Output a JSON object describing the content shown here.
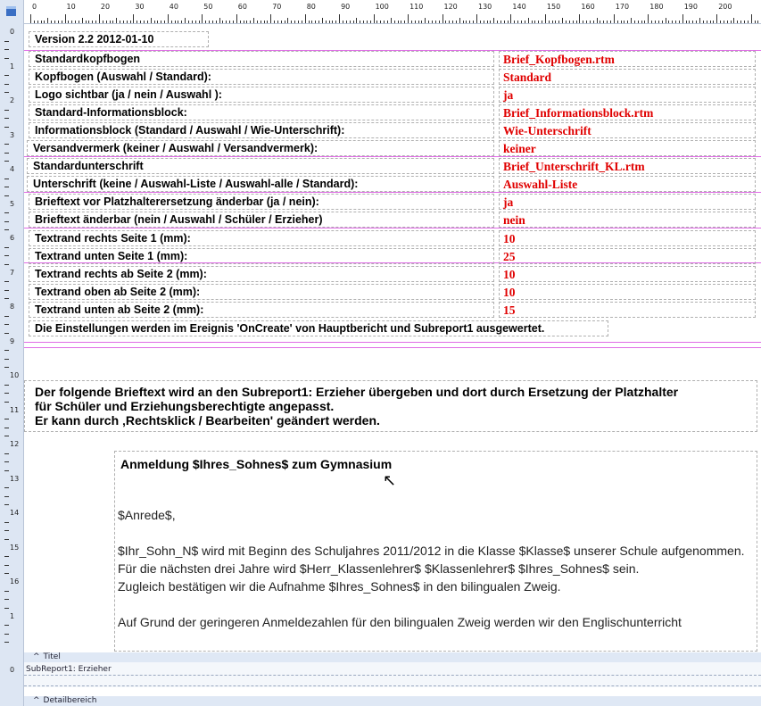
{
  "ruler": {
    "top_labels": [
      "0",
      "10",
      "20",
      "30",
      "40",
      "50",
      "60",
      "70",
      "80",
      "90",
      "100",
      "110",
      "120",
      "130",
      "140",
      "150",
      "160",
      "170",
      "180",
      "190",
      "200"
    ],
    "left_labels": [
      "0",
      "1",
      "2",
      "3",
      "4",
      "5",
      "6",
      "7",
      "8",
      "9",
      "10",
      "11",
      "12",
      "13",
      "14",
      "15",
      "16",
      "1"
    ]
  },
  "settings": {
    "version": "Version 2.2 2012-01-10",
    "rows": [
      {
        "label": "Standardkopfbogen",
        "value": "Brief_Kopfbogen.rtm"
      },
      {
        "label": "Kopfbogen  (Auswahl / Standard):",
        "value": "Standard"
      },
      {
        "label": "Logo sichtbar  (ja / nein / Auswahl ):",
        "value": "ja"
      },
      {
        "label": "Standard-Informationsblock:",
        "value": "Brief_Informationsblock.rtm"
      },
      {
        "label": "Informationsblock (Standard / Auswahl / Wie-Unterschrift):",
        "value": "Wie-Unterschrift"
      },
      {
        "label": "Versandvermerk (keiner / Auswahl / Versandvermerk):",
        "value": "keiner"
      },
      {
        "label": "Standardunterschrift",
        "value": "Brief_Unterschrift_KL.rtm"
      },
      {
        "label": "Unterschrift (keine / Auswahl-Liste / Auswahl-alle / Standard):",
        "value": "Auswahl-Liste"
      },
      {
        "label": "Brieftext vor Platzhalterersetzung änderbar (ja / nein):",
        "value": "ja"
      },
      {
        "label": "Brieftext änderbar (nein / Auswahl  / Schüler / Erzieher)",
        "value": "nein"
      },
      {
        "label": "Textrand rechts Seite 1       (mm):",
        "value": "10"
      },
      {
        "label": "Textrand unten Seite 1        (mm):",
        "value": "25"
      },
      {
        "label": "Textrand rechts ab Seite 2  (mm):",
        "value": "10"
      },
      {
        "label": "Textrand oben ab Seite 2     (mm):",
        "value": "10"
      },
      {
        "label": "Textrand unten ab Seite 2   (mm):",
        "value": "15"
      }
    ],
    "evaluation_note": "Die Einstellungen werden im Ereignis 'OnCreate' von Hauptbericht und Subreport1 ausgewertet."
  },
  "note": {
    "line1": "Der folgende Brieftext wird an den Subreport1: Erzieher übergeben und dort durch Ersetzung der Platzhalter",
    "line2": "für Schüler und Erziehungsberechtigte angepasst.",
    "line3": "Er kann durch ‚Rechtsklick / Bearbeiten' geändert werden."
  },
  "letter": {
    "subject": "Anmeldung $Ihres_Sohnes$ zum Gymnasium",
    "salutation": "$Anrede$,",
    "p1": "$Ihr_Sohn_N$ wird mit Beginn des Schuljahres 2011/2012 in die Klasse $Klasse$ unserer Schule aufgenommen.",
    "p2": "Für die nächsten drei Jahre wird $Herr_Klassenlehrer$ $Klassenlehrer$ $Ihres_Sohnes$ sein.",
    "p3": "Zugleich bestätigen wir die Aufnahme $Ihres_Sohnes$ in den bilingualen Zweig.",
    "p4": "Auf Grund der geringeren Anmeldezahlen für den bilingualen Zweig werden wir den Englischunterricht"
  },
  "bands": {
    "titel": "Titel",
    "subreport": "SubReport1: Erzieher",
    "detail": "Detailbereich",
    "sub_ruler": "0"
  },
  "colors": {
    "value_red": "#e00000",
    "guide_magenta": "#e06ce6",
    "band_blue": "#dfe8f5"
  }
}
